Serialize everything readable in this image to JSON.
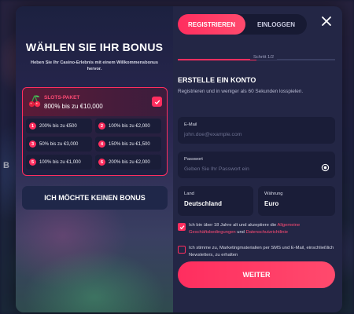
{
  "bonus_panel": {
    "title": "WÄHLEN SIE IHR BONUS",
    "subtitle": "Heben Sie Ihr Casino-Erlebnis mit einem Willkommensbonus hervor.",
    "package": {
      "name": "SLOTS-PAKET",
      "amount": "800% bis zu €10,000",
      "selected": true,
      "tiers": [
        {
          "num": "1",
          "text": "200% bis zu €500"
        },
        {
          "num": "2",
          "text": "100% bis zu €2,000"
        },
        {
          "num": "3",
          "text": "50% bis zu €3,000"
        },
        {
          "num": "4",
          "text": "150% bis zu €1,500"
        },
        {
          "num": "5",
          "text": "100% bis zu €1,000"
        },
        {
          "num": "6",
          "text": "200% bis zu €2,000"
        }
      ]
    },
    "no_bonus_label": "ICH MÖCHTE KEINEN BONUS"
  },
  "form": {
    "tabs": {
      "register": "REGISTRIEREN",
      "login": "EINLOGGEN"
    },
    "step": "Schritt 1/2",
    "step_progress": 0.5,
    "title": "ERSTELLE EIN KONTO",
    "subtitle": "Registrieren und in weniger als 60 Sekunden losspielen.",
    "email": {
      "label": "E-Mail",
      "placeholder": "john.doe@example.com"
    },
    "password": {
      "label": "Passwort",
      "placeholder": "Geben Sie Ihr Passwort ein"
    },
    "country": {
      "label": "Land",
      "value": "Deutschland"
    },
    "currency": {
      "label": "Währung",
      "value": "Euro"
    },
    "terms": {
      "checked": true,
      "text_before": "Ich bin über 18 Jahre alt und akzeptiere die ",
      "link1": "Allgemeine Geschäftsbedingungen",
      "text_mid": " und ",
      "link2": "Datenschutzrichtlinie"
    },
    "marketing": {
      "checked": false,
      "text": "Ich stimme zu, Marketingmaterialien per SMS und E-Mail, einschließlich Newsletters, zu erhalten"
    },
    "submit_label": "WEITER"
  },
  "colors": {
    "accent": "#ff2e5f",
    "panel": "#232645",
    "field": "#1a1d38"
  },
  "icons": [
    "cherry-icon",
    "check-icon",
    "close-icon",
    "eye-icon"
  ]
}
